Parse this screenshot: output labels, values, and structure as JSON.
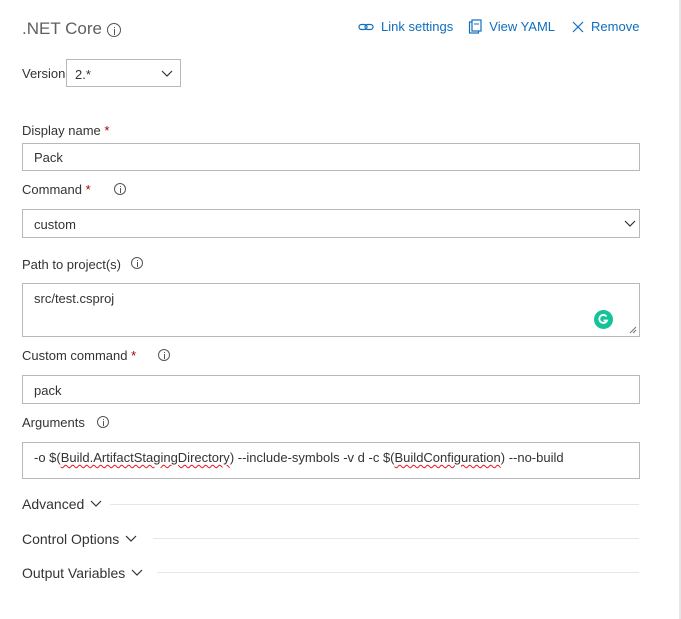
{
  "task": {
    "title": ".NET Core",
    "links": {
      "link_settings": "Link settings",
      "view_yaml": "View YAML",
      "remove": "Remove"
    }
  },
  "version": {
    "label": "Version",
    "value": "2.*"
  },
  "display_name": {
    "label": "Display name",
    "required": "*",
    "value": "Pack"
  },
  "command": {
    "label": "Command",
    "required": "*",
    "value": "custom"
  },
  "path_to_projects": {
    "label": "Path to project(s)",
    "value": "src/test.csproj"
  },
  "custom_command": {
    "label": "Custom command",
    "required": "*",
    "value": "pack"
  },
  "arguments": {
    "label": "Arguments",
    "parts": {
      "p1": "-o $(",
      "p2": "Build.ArtifactStagingDirectory",
      "p3": ") --include-symbols -v d -c $(",
      "p4": "BuildConfiguration",
      "p5": ") --no-build"
    }
  },
  "sections": {
    "advanced": "Advanced",
    "control_options": "Control Options",
    "output_variables": "Output Variables"
  },
  "colors": {
    "link": "#106ebe",
    "required": "#a80000",
    "grammarly": "#15c39a",
    "border": "#b8b8b8"
  }
}
